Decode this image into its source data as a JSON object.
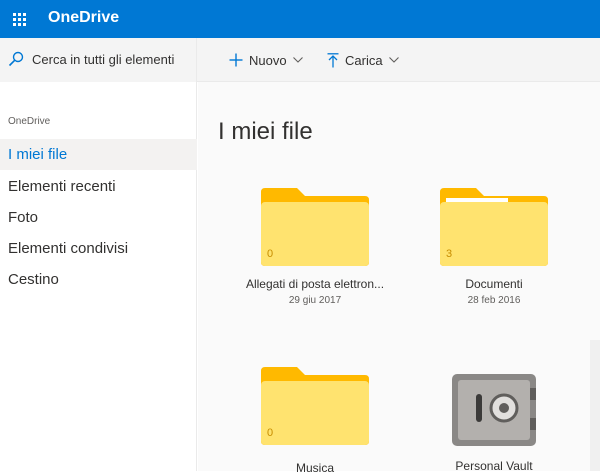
{
  "app": {
    "title": "OneDrive"
  },
  "search": {
    "placeholder": "Cerca in tutti gli elementi"
  },
  "toolbar": {
    "new_label": "Nuovo",
    "upload_label": "Carica"
  },
  "sidebar": {
    "heading": "OneDrive",
    "items": [
      {
        "label": "I miei file",
        "active": true
      },
      {
        "label": "Elementi recenti"
      },
      {
        "label": "Foto"
      },
      {
        "label": "Elementi condivisi"
      },
      {
        "label": "Cestino"
      }
    ]
  },
  "main": {
    "title": "I miei file",
    "items": [
      {
        "name": "Allegati di posta elettron...",
        "date": "29 giu 2017",
        "count": "0",
        "type": "folder"
      },
      {
        "name": "Documenti",
        "date": "28 feb 2016",
        "count": "3",
        "type": "folder-docs"
      },
      {
        "name": "Musica",
        "date": "",
        "count": "0",
        "type": "folder"
      },
      {
        "name": "Personal Vault",
        "date": "",
        "count": "",
        "type": "vault"
      }
    ]
  },
  "colors": {
    "brand": "#0078d4",
    "folder": "#ffe36f",
    "folder_tab": "#ffb900"
  }
}
